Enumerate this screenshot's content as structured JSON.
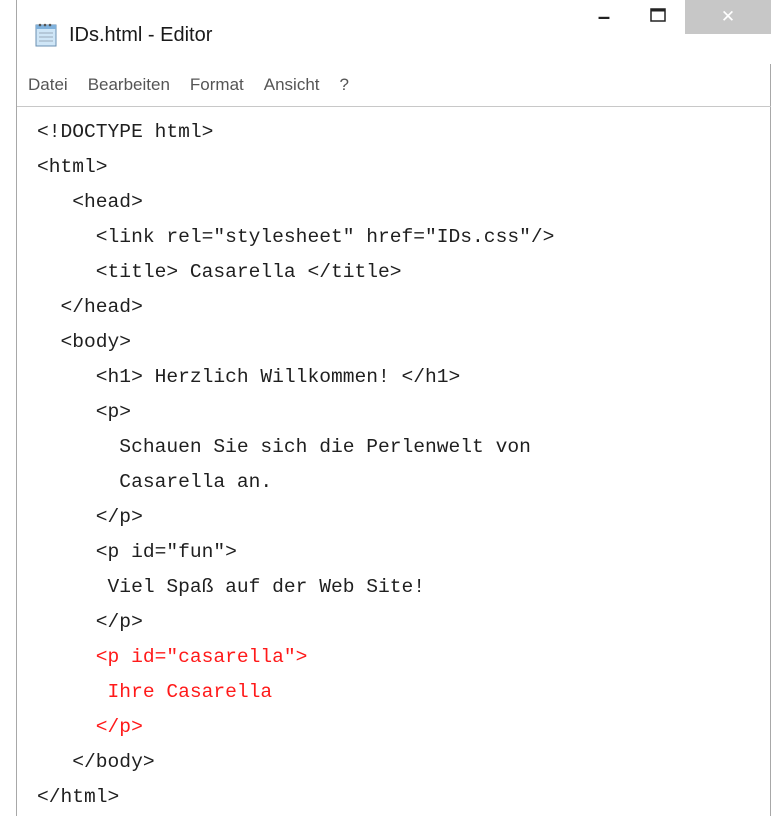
{
  "window": {
    "title": "IDs.html - Editor",
    "minimize_glyph": "–",
    "close_glyph": "✕",
    "colors": {
      "close_bg": "#c7c7c7",
      "highlight": "#ff1a1a"
    }
  },
  "menu": [
    {
      "label": "Datei"
    },
    {
      "label": "Bearbeiten"
    },
    {
      "label": "Format"
    },
    {
      "label": "Ansicht"
    },
    {
      "label": "?"
    }
  ],
  "document": {
    "lines": [
      {
        "text": "<!DOCTYPE html>",
        "highlight": false
      },
      {
        "text": "<html>",
        "highlight": false
      },
      {
        "text": "   <head>",
        "highlight": false
      },
      {
        "text": "     <link rel=\"stylesheet\" href=\"IDs.css\"/>",
        "highlight": false
      },
      {
        "text": "     <title> Casarella </title>",
        "highlight": false
      },
      {
        "text": "  </head>",
        "highlight": false
      },
      {
        "text": "  <body>",
        "highlight": false
      },
      {
        "text": "     <h1> Herzlich Willkommen! </h1>",
        "highlight": false
      },
      {
        "text": "     <p>",
        "highlight": false
      },
      {
        "text": "       Schauen Sie sich die Perlenwelt von",
        "highlight": false
      },
      {
        "text": "       Casarella an.",
        "highlight": false
      },
      {
        "text": "     </p>",
        "highlight": false
      },
      {
        "text": "     <p id=\"fun\">",
        "highlight": false
      },
      {
        "text": "      Viel Spaß auf der Web Site!",
        "highlight": false
      },
      {
        "text": "     </p>",
        "highlight": false
      },
      {
        "text": "     <p id=\"casarella\">",
        "highlight": true
      },
      {
        "text": "      Ihre Casarella",
        "highlight": true
      },
      {
        "text": "     </p>",
        "highlight": true
      },
      {
        "text": "   </body>",
        "highlight": false
      },
      {
        "text": "</html>",
        "highlight": false
      }
    ]
  }
}
